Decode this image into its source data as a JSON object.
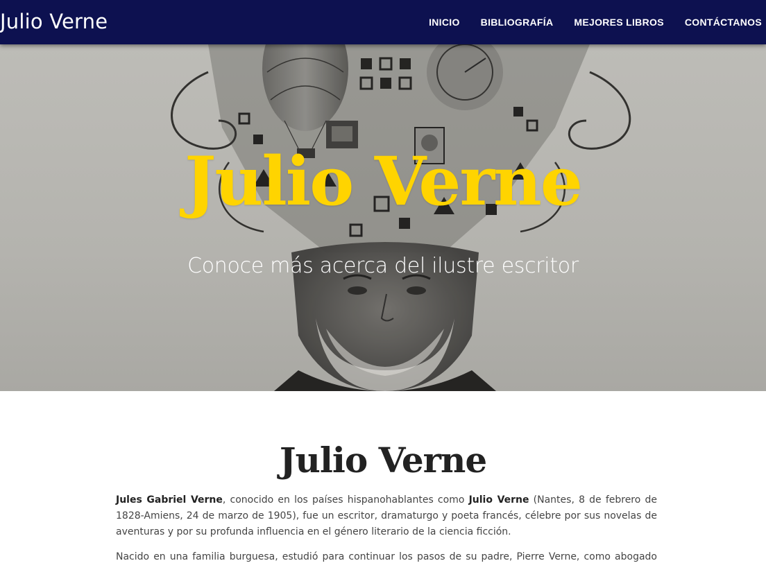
{
  "navbar": {
    "brand": "Julio Verne",
    "links": [
      "INICIO",
      "BIBLIOGRAFÍA",
      "MEJORES LIBROS",
      "CONTÁCTANOS"
    ]
  },
  "hero": {
    "title": "Julio Verne",
    "subtitle": "Conoce más acerca del ilustre escritor"
  },
  "section": {
    "title": "Julio Verne",
    "p1": {
      "name_bold": "Jules Gabriel Verne",
      "text_a": ", conocido en los países hispanohablantes como ",
      "alias_bold": "Julio Verne",
      "text_b": " (Nantes, 8 de febrero de 1828-Amiens, 24 de marzo de 1905), fue un escritor, dramaturgo y poeta francés, célebre por sus novelas de aventuras y por su profunda influencia en el género literario de la ciencia ficción."
    },
    "p2": "Nacido en una familia burguesa, estudió para continuar los pasos de su padre, Pierre Verne, como abogado pero muy"
  },
  "colors": {
    "navbar": "#0d1150",
    "hero_title": "#ffd400",
    "hero_subtitle": "#ffffff"
  }
}
